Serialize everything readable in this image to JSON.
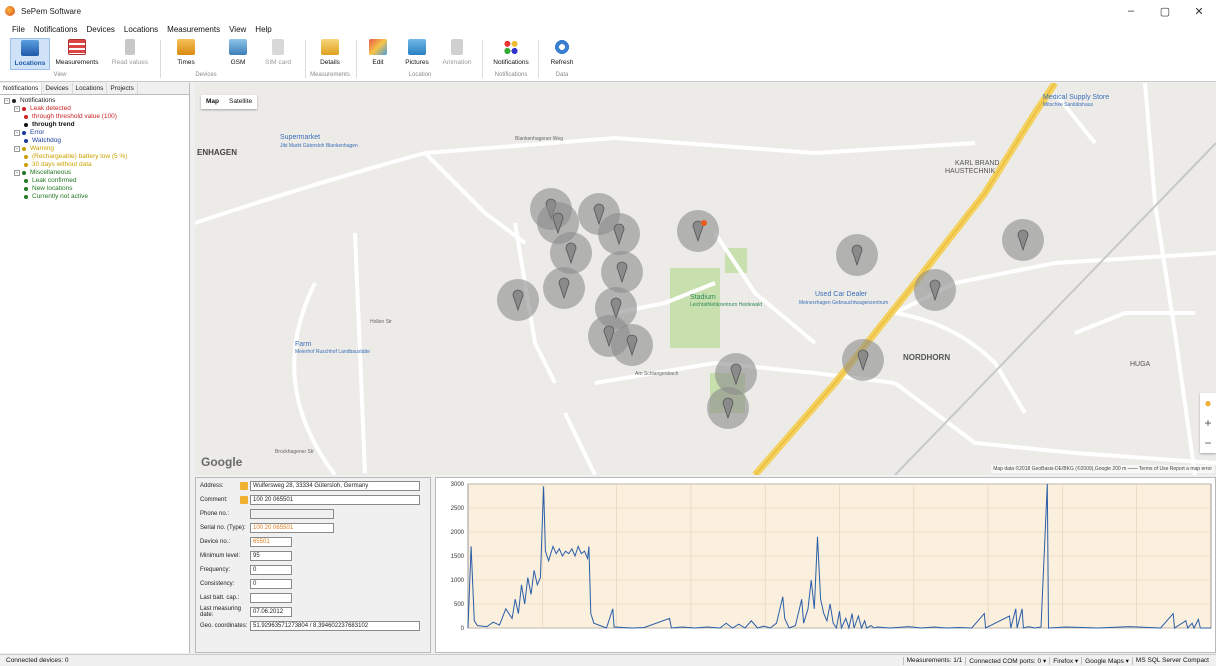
{
  "window": {
    "title": "SePem Software",
    "minimize": "–",
    "maximize": "▢",
    "close": "✕"
  },
  "menu": [
    "File",
    "Notifications",
    "Devices",
    "Locations",
    "Measurements",
    "View",
    "Help"
  ],
  "ribbon": {
    "locations": "Locations",
    "measurements": "Measurements",
    "read_values": "Read values",
    "times": "Times",
    "gsm": "GSM",
    "sim_card": "SIM card",
    "details": "Details",
    "edit": "Edit",
    "pictures": "Pictures",
    "animation": "Animation",
    "notifications": "Notifications",
    "refresh": "Refresh",
    "groups": {
      "view": "View",
      "devices": "Devices",
      "measurements": "Measurements",
      "location": "Location",
      "notifications": "Notifications",
      "data": "Data"
    }
  },
  "left_tabs": [
    "Notifications",
    "Devices",
    "Locations",
    "Projects"
  ],
  "tree": [
    {
      "label": "Notifications",
      "level": 0,
      "color": "#222222"
    },
    {
      "label": "Leak detected",
      "level": 1,
      "color": "#cc2222"
    },
    {
      "label": "through threshold value (100)",
      "level": 2,
      "color": "#cc2222"
    },
    {
      "label": "through trend",
      "level": 2,
      "color": "#111111",
      "bold": true
    },
    {
      "label": "Error",
      "level": 1,
      "color": "#1a3a9a"
    },
    {
      "label": "Watchdog",
      "level": 2,
      "color": "#1a3a9a"
    },
    {
      "label": "Warning",
      "level": 1,
      "color": "#c9a000"
    },
    {
      "label": "(Rechargeable) battery low (5 %)",
      "level": 2,
      "color": "#c9a000"
    },
    {
      "label": "30 days without data",
      "level": 2,
      "color": "#c9a000"
    },
    {
      "label": "Miscellaneous",
      "level": 1,
      "color": "#227722"
    },
    {
      "label": "Leak confirmed",
      "level": 2,
      "color": "#227722"
    },
    {
      "label": "New locations",
      "level": 2,
      "color": "#227722"
    },
    {
      "label": "Currently not active",
      "level": 2,
      "color": "#227722"
    }
  ],
  "map": {
    "type_buttons": [
      "Map",
      "Satellite"
    ],
    "google": "Google",
    "attribution": "Map data ©2018 GeoBasis-DE/BKG (©2009),Google   200 m ⎯⎯⎯⎯   Terms of Use   Report a map error",
    "zoom_in": "+",
    "zoom_out": "−",
    "labels": {
      "enhagen": "ENHAGEN",
      "supermarket": "Supermarket",
      "supermarket_sub": "Jibi Markt Gütersloh Blankenhagen",
      "karl_brand": "KARL BRAND",
      "haustechnik": "HAUSTECHNIK",
      "medical": "Medical Supply Store",
      "medical_sub": "Mitschke Sanitätshaus",
      "used_car": "Used Car Dealer",
      "used_car_sub": "Meinerzhagen Gebrauchtwagenzentrum",
      "stadium": "Stadium",
      "stadium_sub": "Leichtathletikzentrum Heidewald",
      "farm": "Farm",
      "farm_sub": "Meierhof Ruschhof Landbaustätte",
      "nordhorn": "NORDHORN",
      "huga": "HUGA",
      "schlangenbach": "Am Schlangenbach",
      "blankenhagener": "Blankenhagener Weg",
      "hollen": "Hollen Str",
      "brockhagener": "Brockhagener Str"
    }
  },
  "details": {
    "address_label": "Address:",
    "address": "Wulfersweg 28, 33334 Gütersloh, Germany",
    "comment_label": "Comment:",
    "comment": "100 20 065501",
    "phone_label": "Phone no.:",
    "phone": "",
    "serial_label": "Serial no. (Type):",
    "serial": "100 20 065501",
    "device_label": "Device no.:",
    "device": "65501",
    "min_level_label": "Minimum level:",
    "min_level": "95",
    "frequency_label": "Frequency:",
    "frequency": "0",
    "consistency_label": "Consistency:",
    "consistency": "0",
    "last_batt_label": "Last batt. cap.:",
    "last_batt": "",
    "last_meas_label": "Last measuring date:",
    "last_meas": "07.06.2012",
    "geo_label": "Geo. coordinates:",
    "geo": "51.92963571273804 / 8.394602237683102"
  },
  "chart_data": {
    "type": "line",
    "yticks": [
      0,
      500,
      1000,
      1500,
      2000,
      2500,
      3000
    ],
    "ylim": [
      0,
      3000
    ],
    "xlim": [
      0,
      100
    ],
    "line_color": "#2a5ea8",
    "points": [
      [
        0,
        0
      ],
      [
        0.5,
        1700
      ],
      [
        1,
        150
      ],
      [
        1.5,
        50
      ],
      [
        3,
        30
      ],
      [
        4,
        120
      ],
      [
        5,
        60
      ],
      [
        6,
        400
      ],
      [
        7,
        200
      ],
      [
        7.5,
        600
      ],
      [
        8,
        300
      ],
      [
        8.5,
        900
      ],
      [
        9,
        500
      ],
      [
        9.5,
        1050
      ],
      [
        10,
        700
      ],
      [
        10.5,
        1200
      ],
      [
        11,
        900
      ],
      [
        11.5,
        1050
      ],
      [
        12,
        2950
      ],
      [
        12.3,
        1600
      ],
      [
        12.8,
        1400
      ],
      [
        13.5,
        1700
      ],
      [
        14,
        1550
      ],
      [
        14.5,
        1650
      ],
      [
        15,
        1500
      ],
      [
        15.5,
        1600
      ],
      [
        16,
        1550
      ],
      [
        16.5,
        1650
      ],
      [
        17,
        1500
      ],
      [
        17.5,
        1700
      ],
      [
        18,
        1550
      ],
      [
        18.5,
        1600
      ],
      [
        19,
        1450
      ],
      [
        19.2,
        1700
      ],
      [
        19.5,
        300
      ],
      [
        20,
        100
      ],
      [
        21,
        50
      ],
      [
        22,
        0
      ],
      [
        23,
        400
      ],
      [
        23.2,
        20
      ],
      [
        26,
        0
      ],
      [
        28,
        10
      ],
      [
        32,
        200
      ],
      [
        32.3,
        0
      ],
      [
        34,
        20
      ],
      [
        36,
        0
      ],
      [
        38,
        20
      ],
      [
        40,
        0
      ],
      [
        41,
        100
      ],
      [
        42,
        0
      ],
      [
        43,
        80
      ],
      [
        44,
        0
      ],
      [
        45,
        150
      ],
      [
        46,
        0
      ],
      [
        47,
        40
      ],
      [
        48,
        0
      ],
      [
        49,
        100
      ],
      [
        50,
        650
      ],
      [
        50.3,
        200
      ],
      [
        51,
        0
      ],
      [
        52,
        50
      ],
      [
        53,
        600
      ],
      [
        53.3,
        100
      ],
      [
        54,
        400
      ],
      [
        54.5,
        1000
      ],
      [
        55,
        400
      ],
      [
        55.5,
        1900
      ],
      [
        56,
        600
      ],
      [
        56.5,
        300
      ],
      [
        57,
        150
      ],
      [
        57.5,
        500
      ],
      [
        58,
        100
      ],
      [
        58.5,
        0
      ],
      [
        59,
        350
      ],
      [
        59.3,
        0
      ],
      [
        60,
        200
      ],
      [
        60.5,
        0
      ],
      [
        61,
        300
      ],
      [
        61.3,
        0
      ],
      [
        62,
        250
      ],
      [
        62.5,
        0
      ],
      [
        63,
        150
      ],
      [
        63.3,
        0
      ],
      [
        64,
        50
      ],
      [
        64.5,
        0
      ],
      [
        65,
        20
      ],
      [
        67,
        0
      ],
      [
        70,
        30
      ],
      [
        72,
        0
      ],
      [
        74,
        20
      ],
      [
        76,
        0
      ],
      [
        78,
        10
      ],
      [
        80,
        0
      ],
      [
        82,
        300
      ],
      [
        82.2,
        0
      ],
      [
        86,
        250
      ],
      [
        86.2,
        0
      ],
      [
        87,
        400
      ],
      [
        87.2,
        0
      ],
      [
        88,
        400
      ],
      [
        88.2,
        0
      ],
      [
        89,
        30
      ],
      [
        90,
        0
      ],
      [
        91,
        20
      ],
      [
        92,
        3000
      ],
      [
        92.2,
        0
      ],
      [
        95,
        20
      ],
      [
        100,
        0
      ],
      [
        105,
        30
      ],
      [
        110,
        0
      ],
      [
        112,
        300
      ],
      [
        112.2,
        0
      ],
      [
        114,
        150
      ],
      [
        114.3,
        0
      ],
      [
        115,
        100
      ],
      [
        115.3,
        0
      ],
      [
        116,
        180
      ],
      [
        116.3,
        0
      ],
      [
        118,
        0
      ]
    ]
  },
  "status": {
    "left": "Connected devices: 0",
    "measurements": "Measurements: 1/1",
    "com": "Connected COM ports: 0 ▾",
    "browser": "Firefox ▾",
    "maps": "Google Maps ▾",
    "db": "MS SQL Server Compact"
  }
}
